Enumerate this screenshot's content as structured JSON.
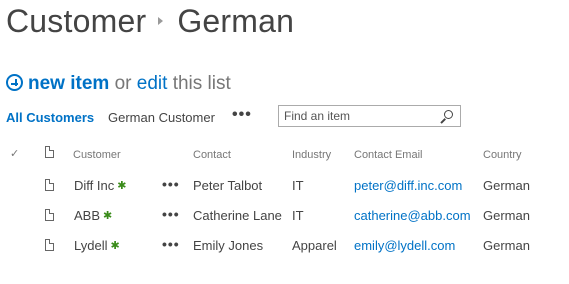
{
  "page": {
    "title": "Customer",
    "subtitle": "German"
  },
  "actions": {
    "new_item": "new item",
    "or": "or",
    "edit": "edit",
    "this_list": "this list"
  },
  "views": {
    "items": [
      "All Customers",
      "German Customer"
    ],
    "more": "•••"
  },
  "search": {
    "placeholder": "Find an item"
  },
  "table": {
    "columns": [
      "Customer",
      "Contact",
      "Industry",
      "Contact Email",
      "Country"
    ],
    "rows": [
      {
        "customer": "Diff Inc",
        "contact": "Peter Talbot",
        "industry": "IT",
        "email": "peter@diff.inc.com",
        "country": "German"
      },
      {
        "customer": "ABB",
        "contact": "Catherine Lane",
        "industry": "IT",
        "email": "catherine@abb.com",
        "country": "German"
      },
      {
        "customer": "Lydell",
        "contact": "Emily Jones",
        "industry": "Apparel",
        "email": "emily@lydell.com",
        "country": "German"
      }
    ],
    "new_marker": "✱",
    "row_menu": "•••",
    "check": "✓"
  },
  "colors": {
    "accent": "#0072c6",
    "text": "#444444",
    "muted": "#777777",
    "new_marker": "#3a8c1a"
  }
}
